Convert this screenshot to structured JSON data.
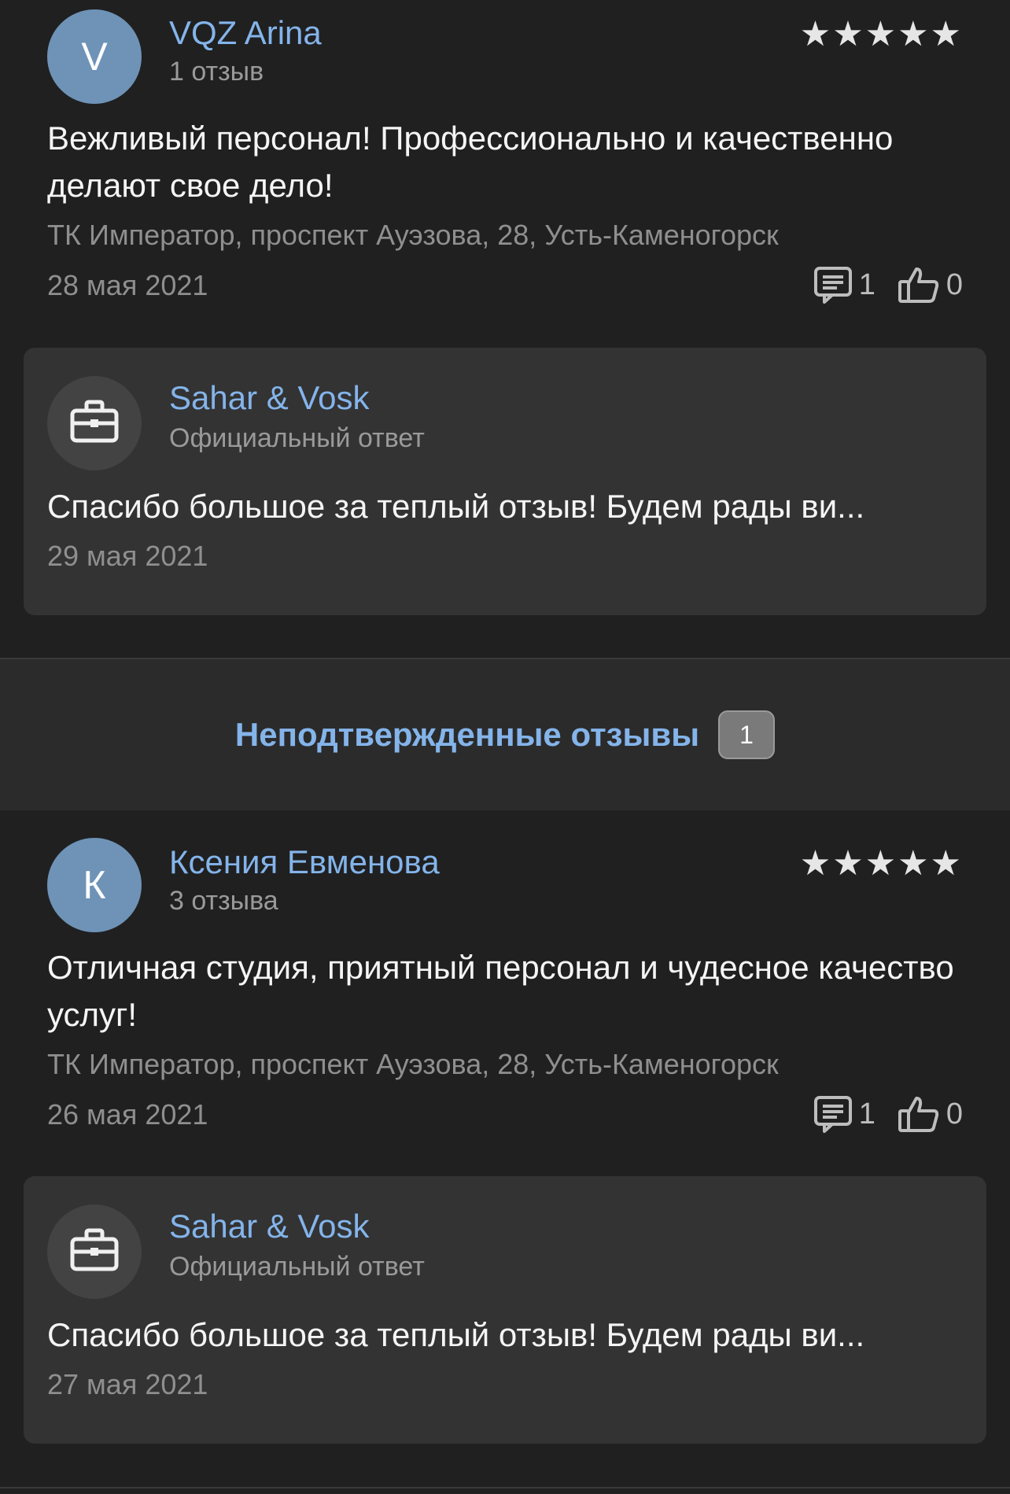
{
  "reviews": [
    {
      "avatar_letter": "V",
      "author": "VQZ Arina",
      "review_count": "1 отзыв",
      "stars": "★★★★★",
      "text": "Вежливый персонал! Профессионально и качественно делают свое дело!",
      "address": "ТК Император, проспект Ауэзова, 28, Усть-Каменогорск",
      "date": "28 мая 2021",
      "comments_count": "1",
      "likes_count": "0",
      "reply": {
        "business_name": "Sahar & Vosk",
        "label": "Официальный ответ",
        "text": "Спасибо большое за теплый отзыв! Будем рады ви...",
        "date": "29 мая 2021"
      }
    },
    {
      "avatar_letter": "К",
      "author": "Ксения Евменова",
      "review_count": "3 отзыва",
      "stars": "★★★★★",
      "text": "Отличная студия, приятный персонал и чудесное качество услуг!",
      "address": "ТК Император, проспект Ауэзова, 28, Усть-Каменогорск",
      "date": "26 мая 2021",
      "comments_count": "1",
      "likes_count": "0",
      "reply": {
        "business_name": "Sahar & Vosk",
        "label": "Официальный ответ",
        "text": "Спасибо большое за теплый отзыв! Будем рады ви...",
        "date": "27 мая 2021"
      }
    }
  ],
  "unconfirmed": {
    "label": "Неподтвержденные отзывы",
    "count": "1"
  },
  "icons": {
    "comment": "comment-icon",
    "like": "thumbs-up-icon",
    "business": "briefcase-icon"
  },
  "colors": {
    "background": "#202021",
    "accent": "#84b4ea",
    "avatar": "#6e93b7",
    "reply_background": "#333334"
  }
}
